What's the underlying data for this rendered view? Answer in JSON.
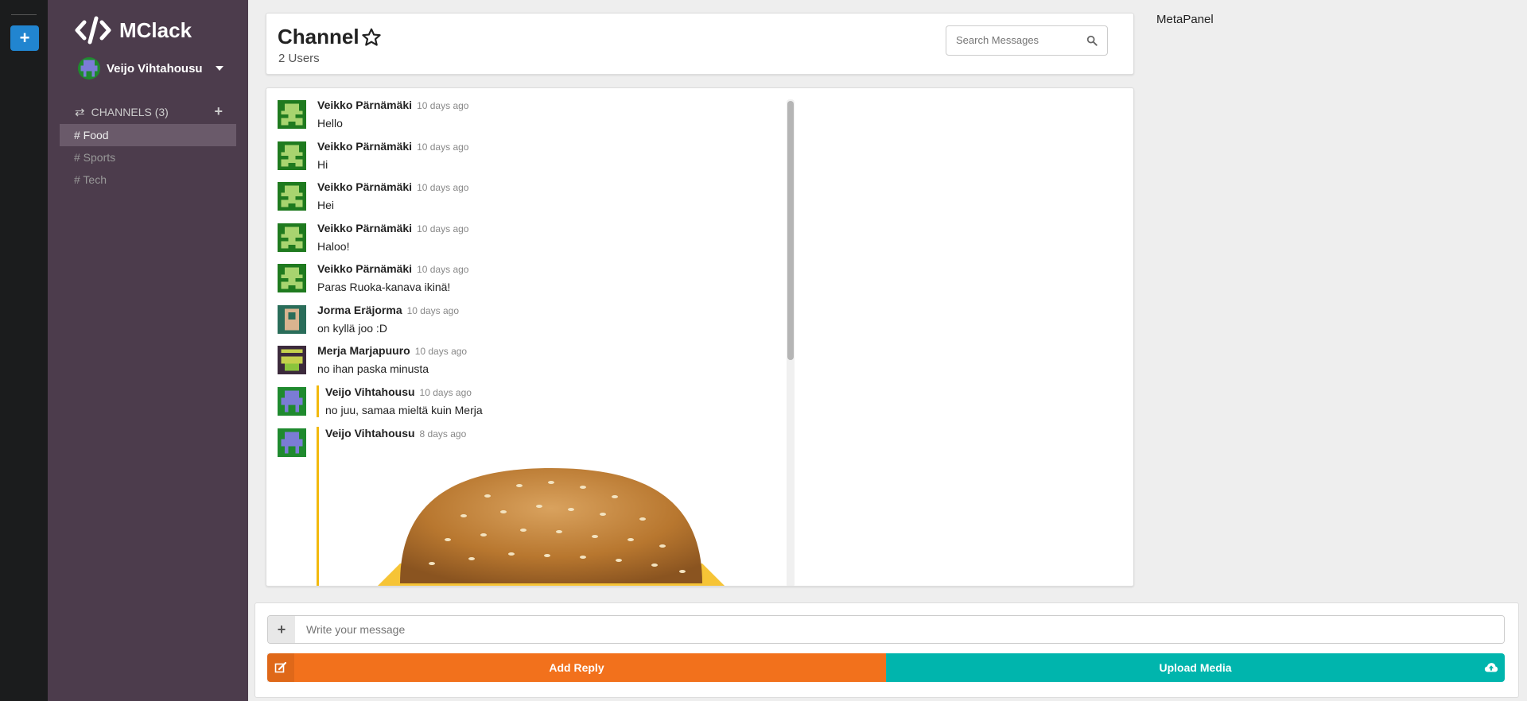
{
  "app": {
    "brand": "MClack",
    "brand_icon": "code-icon",
    "current_user": "Veijo Vihtahousu"
  },
  "sidebar": {
    "channels_label": "CHANNELS (3)",
    "channels": [
      {
        "label": "# Food",
        "active": true
      },
      {
        "label": "# Sports",
        "active": false
      },
      {
        "label": "# Tech",
        "active": false
      }
    ]
  },
  "header": {
    "title": "Channel",
    "user_count": "2 Users",
    "search_placeholder": "Search Messages"
  },
  "messages": [
    {
      "author": "Veikko Pärnämäki",
      "time": "10 days ago",
      "text": "Hello",
      "avatar": "green"
    },
    {
      "author": "Veikko Pärnämäki",
      "time": "10 days ago",
      "text": "Hi",
      "avatar": "green"
    },
    {
      "author": "Veikko Pärnämäki",
      "time": "10 days ago",
      "text": "Hei",
      "avatar": "green"
    },
    {
      "author": "Veikko Pärnämäki",
      "time": "10 days ago",
      "text": "Haloo!",
      "avatar": "green"
    },
    {
      "author": "Veikko Pärnämäki",
      "time": "10 days ago",
      "text": "Paras Ruoka-kanava ikinä!",
      "avatar": "green"
    },
    {
      "author": "Jorma Eräjorma",
      "time": "10 days ago",
      "text": "on kyllä joo :D",
      "avatar": "teal"
    },
    {
      "author": "Merja Marjapuuro",
      "time": "10 days ago",
      "text": "no ihan paska minusta",
      "avatar": "purple"
    },
    {
      "author": "Veijo Vihtahousu",
      "time": "10 days ago",
      "text": "no juu, samaa mieltä kuin Merja",
      "avatar": "blue",
      "own": true
    },
    {
      "author": "Veijo Vihtahousu",
      "time": "8 days ago",
      "text": "",
      "avatar": "blue",
      "own": true,
      "image": "hamburger"
    }
  ],
  "meta_panel": {
    "title": "MetaPanel"
  },
  "composer": {
    "placeholder": "Write your message",
    "reply_label": "Add Reply",
    "upload_label": "Upload Media"
  },
  "colors": {
    "sidebar": "#4c3c4c",
    "rail": "#1b1c1d",
    "reply": "#f2711c",
    "upload": "#00b5ad",
    "own_message_bar": "#f2b90d"
  }
}
